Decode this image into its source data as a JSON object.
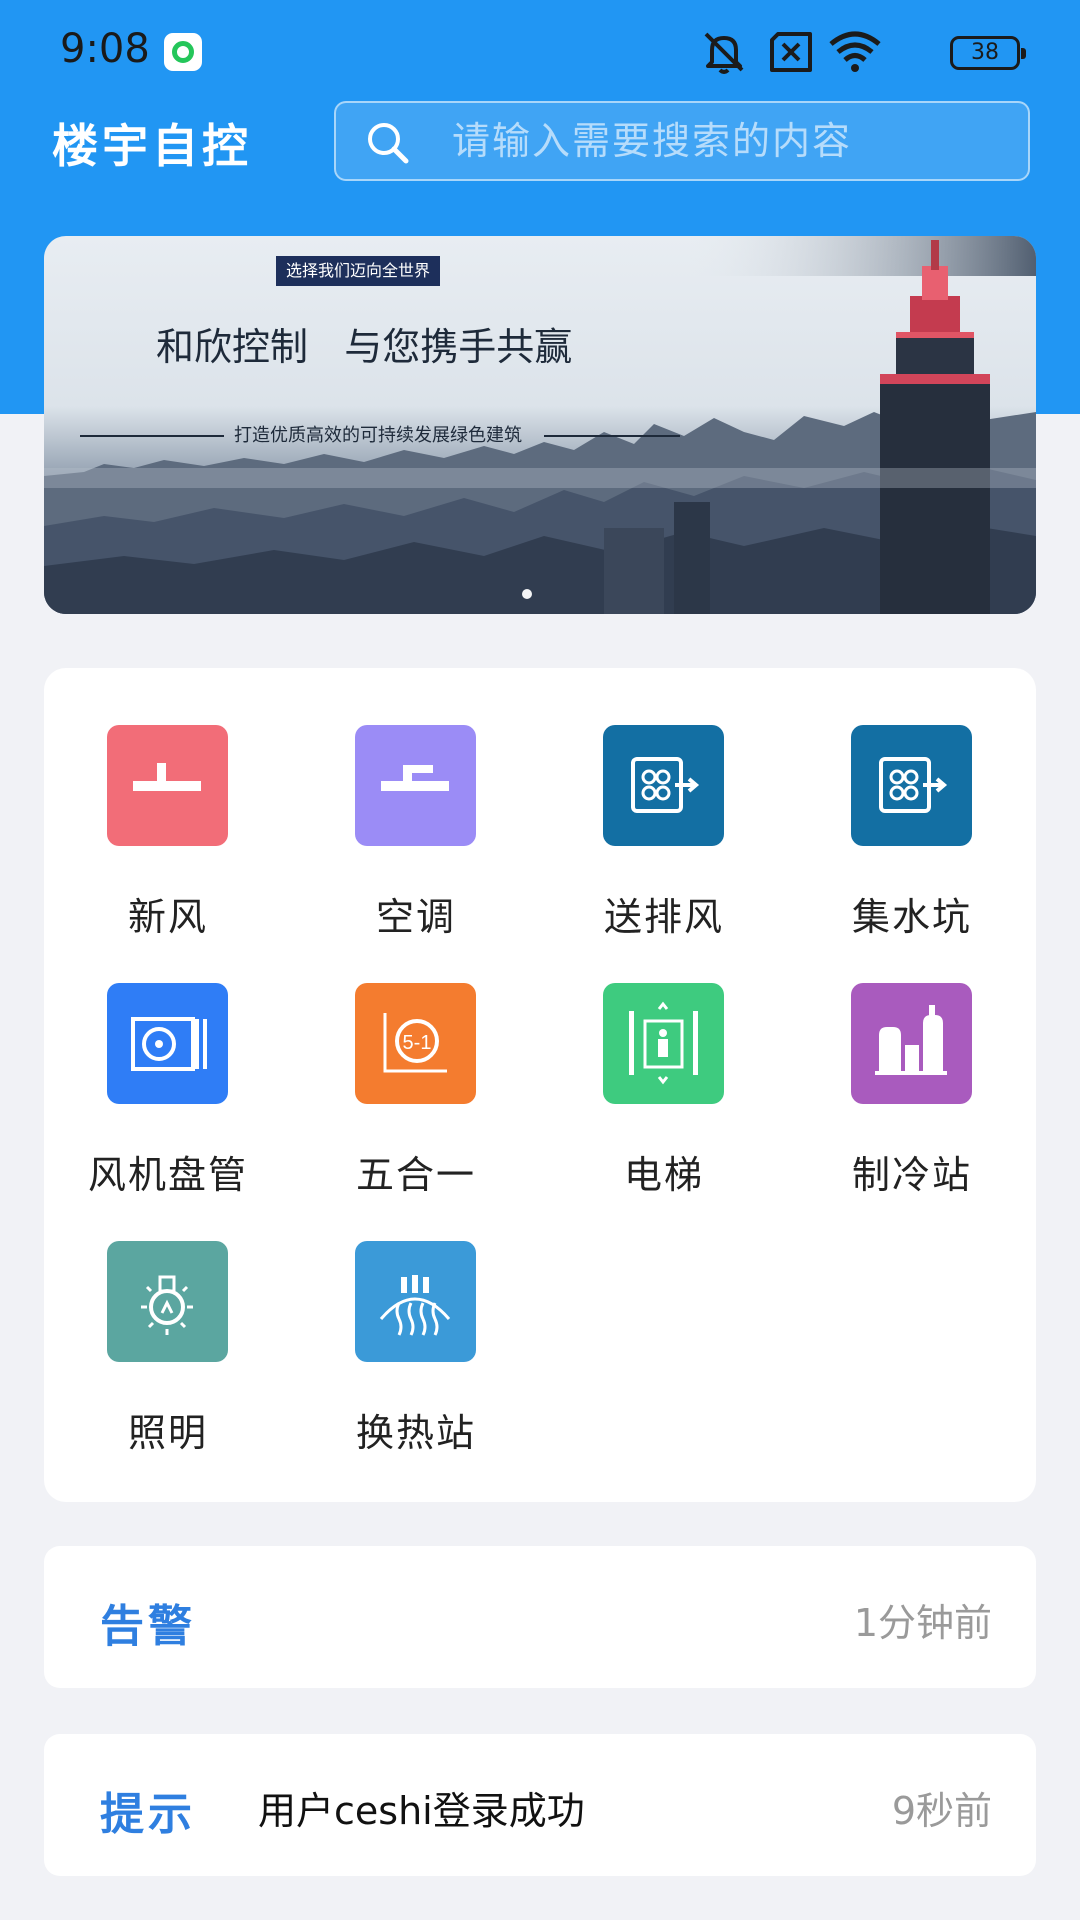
{
  "status_bar": {
    "time": "9:08",
    "battery_level": "38",
    "icons": [
      "app-badge-icon",
      "mute-icon",
      "no-sim-icon",
      "wifi-icon",
      "battery-icon"
    ]
  },
  "header": {
    "title": "楼宇自控",
    "search_placeholder": "请输入需要搜索的内容"
  },
  "banner": {
    "tag": "选择我们迈向全世界",
    "headline": "和欣控制   与您携手共赢",
    "subline": "打造优质高效的可持续发展绿色建筑",
    "page_count": 1,
    "active_page": 1
  },
  "menu": {
    "items": [
      {
        "label": "新风",
        "icon": "fresh-air-icon",
        "color": "#f26d78"
      },
      {
        "label": "空调",
        "icon": "air-conditioner-icon",
        "color": "#9b8cf6"
      },
      {
        "label": "送排风",
        "icon": "ventilation-icon",
        "color": "#136fa3"
      },
      {
        "label": "集水坑",
        "icon": "sump-pit-icon",
        "color": "#136fa3"
      },
      {
        "label": "风机盘管",
        "icon": "fan-coil-icon",
        "color": "#2f7df6"
      },
      {
        "label": "五合一",
        "icon": "five-in-one-icon",
        "color": "#f47c2f"
      },
      {
        "label": "电梯",
        "icon": "elevator-icon",
        "color": "#3ecb7f"
      },
      {
        "label": "制冷站",
        "icon": "refrigeration-station-icon",
        "color": "#a95bbe"
      },
      {
        "label": "照明",
        "icon": "lighting-icon",
        "color": "#5ba6a0"
      },
      {
        "label": "换热站",
        "icon": "heat-exchange-station-icon",
        "color": "#3b9ad8"
      }
    ]
  },
  "notices": [
    {
      "label": "告警",
      "message": "",
      "time": "1分钟前"
    },
    {
      "label": "提示",
      "message": "用户ceshi登录成功",
      "time": "9秒前"
    }
  ],
  "colors": {
    "primary": "#2196f3",
    "background": "#f1f2f6",
    "notice_label": "#2f7fe0"
  }
}
